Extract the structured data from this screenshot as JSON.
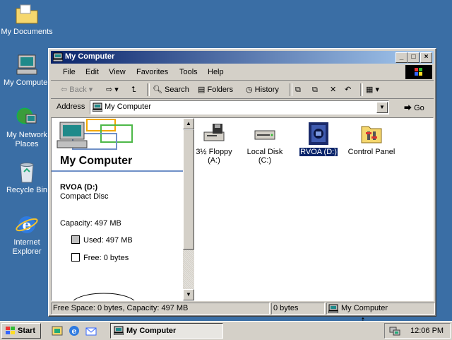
{
  "desktop": {
    "icons": [
      {
        "label": "My Documents"
      },
      {
        "label": "My Computer"
      },
      {
        "label": "My Network Places"
      },
      {
        "label": "Recycle Bin"
      },
      {
        "label": "Internet Explorer"
      }
    ]
  },
  "window": {
    "title": "My Computer",
    "menu": [
      "File",
      "Edit",
      "View",
      "Favorites",
      "Tools",
      "Help"
    ],
    "toolbar": {
      "back": "Back",
      "search": "Search",
      "folders": "Folders",
      "history": "History"
    },
    "address": {
      "label": "Address",
      "value": "My Computer",
      "go": "Go"
    },
    "left_pane": {
      "title": "My Computer",
      "drive_name": "RVOA (D:)",
      "drive_type": "Compact Disc",
      "capacity": "Capacity: 497 MB",
      "used": "Used: 497 MB",
      "free": "Free: 0 bytes"
    },
    "items": [
      {
        "label": "3½ Floppy (A:)",
        "icon": "floppy-drive-icon"
      },
      {
        "label": "Local Disk (C:)",
        "icon": "hard-disk-icon"
      },
      {
        "label": "RVOA (D:)",
        "icon": "cd-drive-icon",
        "selected": true
      },
      {
        "label": "Control Panel",
        "icon": "control-panel-icon"
      }
    ],
    "status": {
      "space": "Free Space: 0 bytes, Capacity: 497 MB",
      "size": "0 bytes",
      "zone": "My Computer"
    }
  },
  "taskbar": {
    "start": "Start",
    "task": "My Computer",
    "clock": "12:06 PM"
  },
  "colors": {
    "desktop": "#3a6ea5",
    "title_start": "#0a246a",
    "title_end": "#a6caf0",
    "selection": "#0a246a"
  }
}
